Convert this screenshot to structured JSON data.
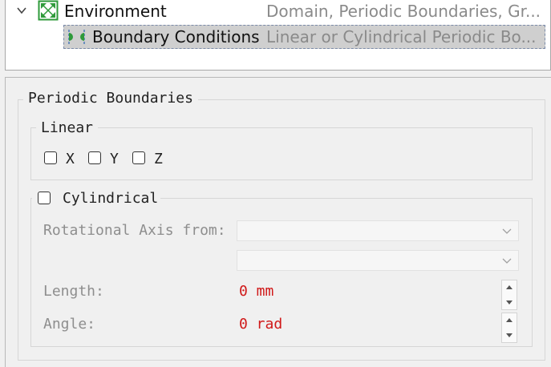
{
  "tree": {
    "environment": {
      "label": "Environment",
      "description": "Domain, Periodic Boundaries, Gr...",
      "icon": "environment-icon",
      "expander": "chevron-down-icon"
    },
    "boundary_conditions": {
      "label": "Boundary Conditions",
      "description": "Linear or Cylindrical Periodic Bo...",
      "icon": "periodic-boundary-icon",
      "selected": true
    }
  },
  "panel": {
    "group_title": "Periodic Boundaries",
    "linear": {
      "title": "Linear",
      "checkboxes": [
        {
          "label": "X",
          "checked": false
        },
        {
          "label": "Y",
          "checked": false
        },
        {
          "label": "Z",
          "checked": false
        }
      ]
    },
    "cylindrical": {
      "title": "Cylindrical",
      "checked": false,
      "rotational_axis_label": "Rotational Axis from:",
      "axis_from_value": "",
      "axis_to_value": "",
      "length_label": "Length:",
      "length_value": "0 mm",
      "angle_label": "Angle:",
      "angle_value": "0 rad"
    }
  },
  "colors": {
    "value_text": "#d01818",
    "disabled_text": "#8e8e8e",
    "selection_bg": "#cfcfcf",
    "env_icon_green": "#2e9a3a"
  }
}
